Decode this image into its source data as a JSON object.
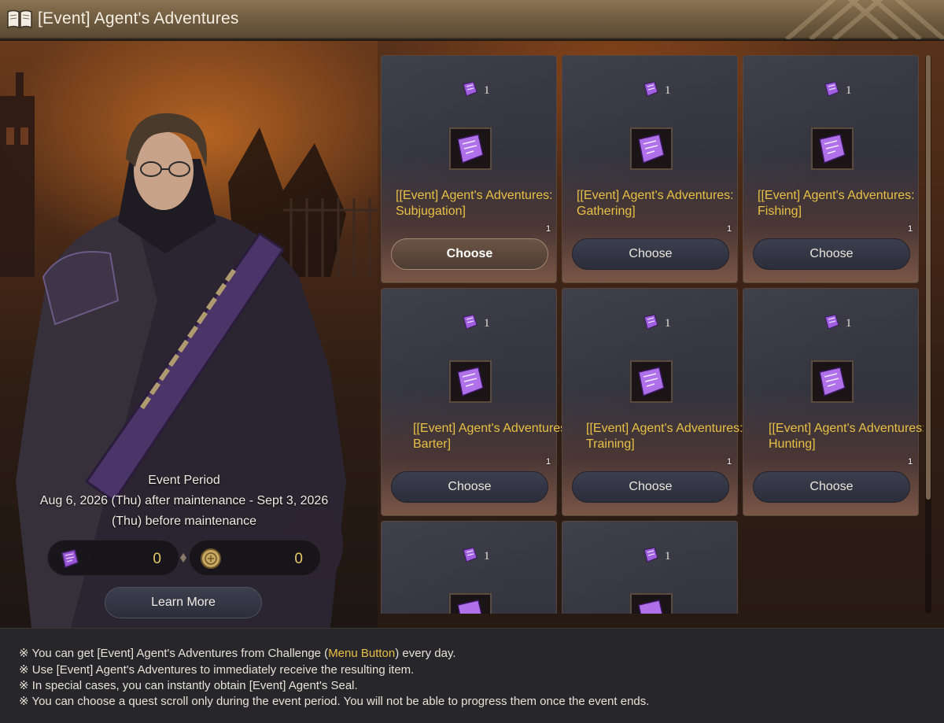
{
  "window": {
    "title": "[Event] Agent's Adventures",
    "icon": "book-icon"
  },
  "event": {
    "period_title": "Event Period",
    "period_text": "Aug 6, 2026 (Thu) after maintenance - Sept 3, 2026 (Thu) before maintenance"
  },
  "counters": [
    {
      "icon": "scroll-icon",
      "value": "0"
    },
    {
      "icon": "seal-coin-icon",
      "value": "0"
    }
  ],
  "learn_more_label": "Learn More",
  "cards": [
    {
      "cost_count": "1",
      "item_count": "1",
      "name": "[[Event] Agent's Adventures: Subjugation]",
      "button": "Choose",
      "active": true
    },
    {
      "cost_count": "1",
      "item_count": "1",
      "name": "[[Event] Agent's Adventures: Gathering]",
      "button": "Choose",
      "active": false
    },
    {
      "cost_count": "1",
      "item_count": "1",
      "name": "[[Event] Agent's Adventures: Fishing]",
      "button": "Choose",
      "active": false
    },
    {
      "cost_count": "1",
      "item_count": "1",
      "name": "[[Event] Agent's Adventures: Barter]",
      "button": "Choose",
      "active": false
    },
    {
      "cost_count": "1",
      "item_count": "1",
      "name": "[[Event] Agent's Adventures: Training]",
      "button": "Choose",
      "active": false
    },
    {
      "cost_count": "1",
      "item_count": "1",
      "name": "[[Event] Agent's Adventures: Hunting]",
      "button": "Choose",
      "active": false
    },
    {
      "cost_count": "1",
      "item_count": "",
      "name": "",
      "button": "",
      "active": false
    },
    {
      "cost_count": "1",
      "item_count": "",
      "name": "",
      "button": "",
      "active": false
    }
  ],
  "notes": {
    "line1_prefix": "※ You can get [Event] Agent's Adventures from Challenge (",
    "line1_highlight": "Menu Button",
    "line1_suffix": ") every day.",
    "line2": "※ Use [Event] Agent's Adventures to immediately receive the resulting item.",
    "line3": "※ In special cases, you can instantly obtain [Event] Agent's Seal.",
    "line4": "※ You can choose a quest scroll only during the event period. You will not be able to progress them once the event ends."
  },
  "colors": {
    "accent_gold": "#e8c044",
    "title_bar": "#7a6448",
    "card_bg": "#3a3a46"
  }
}
